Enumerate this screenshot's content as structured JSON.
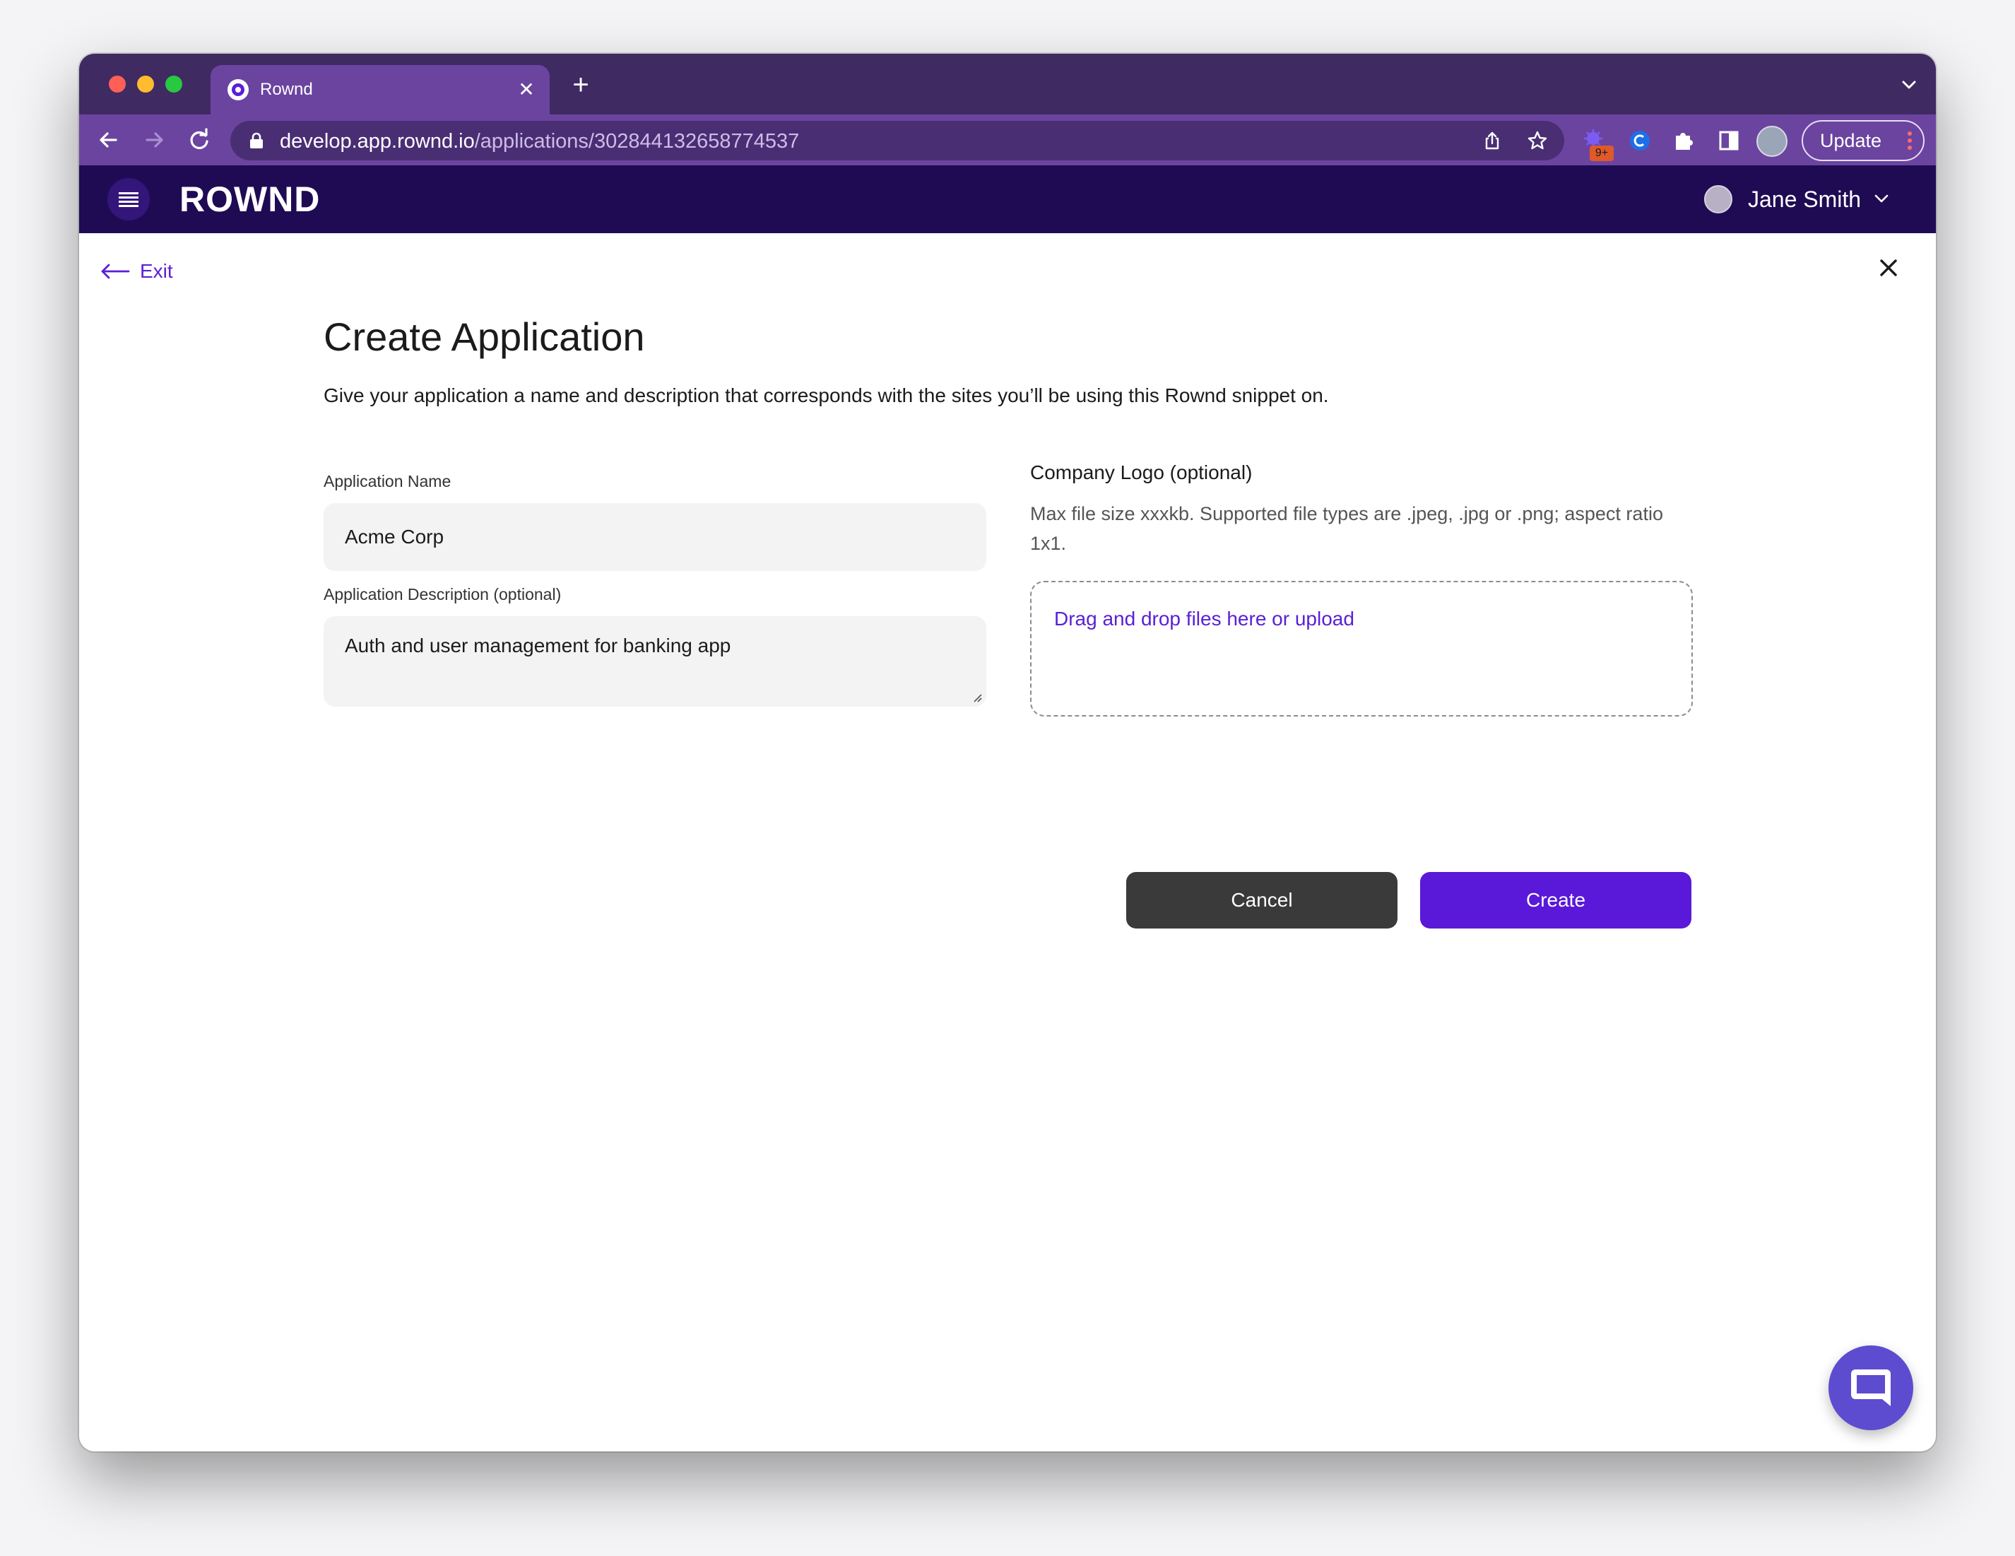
{
  "browser": {
    "tab_title": "Rownd",
    "url_host": "develop.app.rownd.io",
    "url_path": "/applications/302844132658774537",
    "extension_badge": "9+",
    "update_label": "Update"
  },
  "app": {
    "logo": "ROWND",
    "user_name": "Jane Smith"
  },
  "page": {
    "exit_label": "Exit",
    "title": "Create Application",
    "description": "Give your application a name and description that corresponds with the sites you’ll be using this Rownd snippet on."
  },
  "form": {
    "name_label": "Application Name",
    "name_value": "Acme Corp",
    "description_label": "Application Description (optional)",
    "description_value": "Auth and user management for banking app",
    "logo_label": "Company Logo (optional)",
    "logo_hint": "Max file size xxxkb. Supported file types are .jpeg, .jpg or .png; aspect ratio 1x1.",
    "dropzone_text": "Drag and drop files here or upload",
    "cancel_label": "Cancel",
    "create_label": "Create"
  },
  "colors": {
    "brand_purple": "#5a19d8",
    "header_navy": "#1f0b54",
    "cancel_gray": "#3a3a3a"
  }
}
